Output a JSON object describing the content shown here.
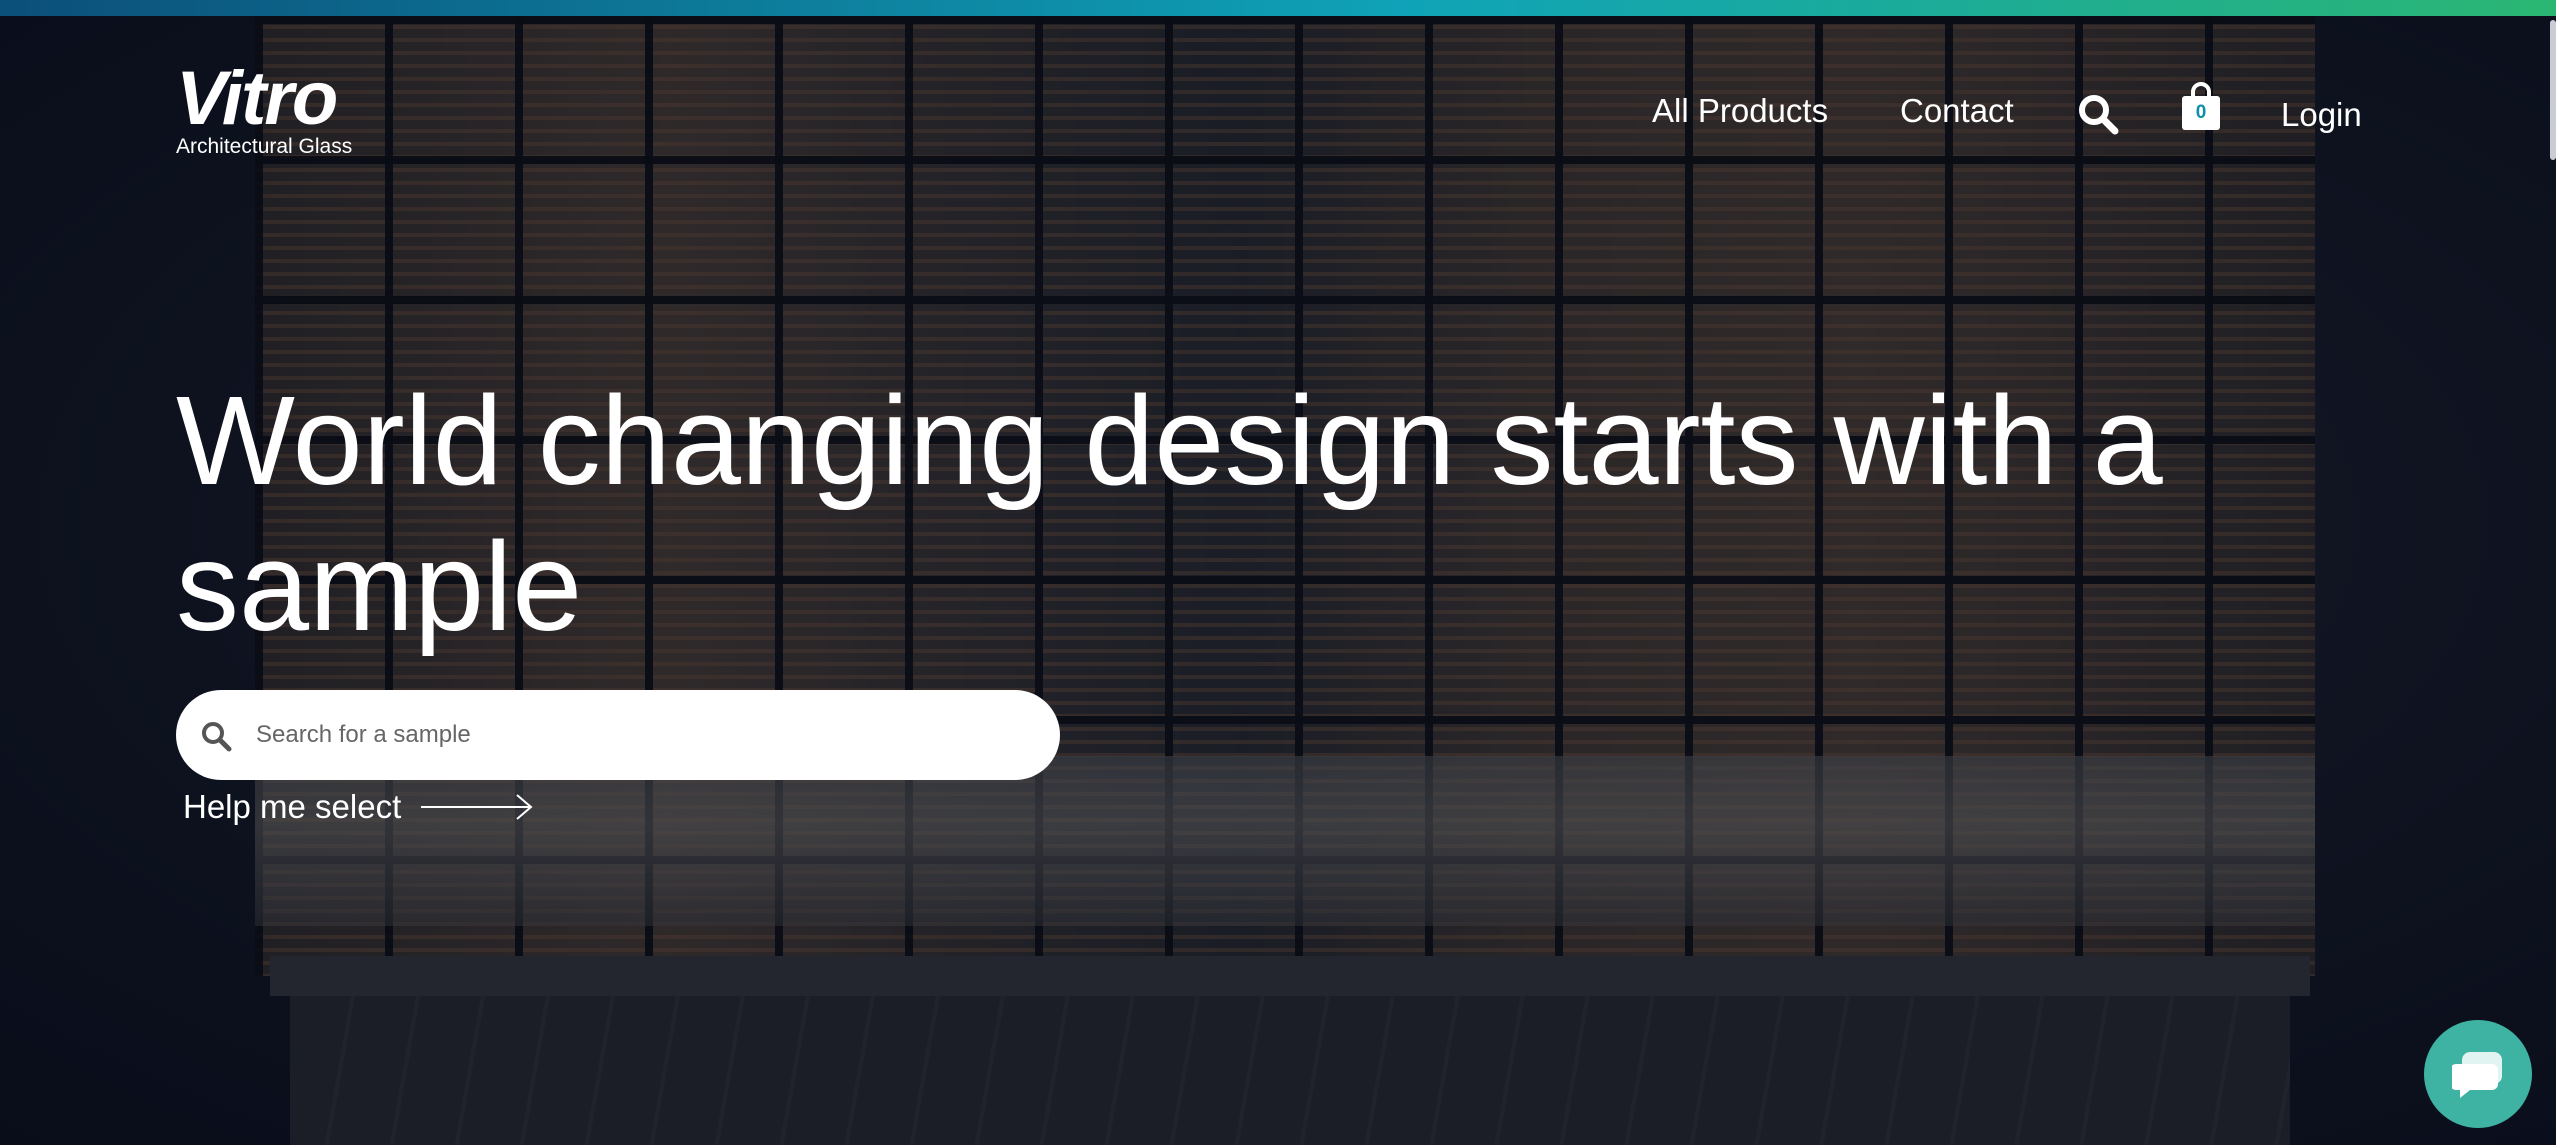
{
  "brand": {
    "logo_text": "Vitro",
    "logo_subtitle": "Architectural Glass",
    "top_accent_gradient": [
      "#0b4f7a",
      "#0fa3b8",
      "#2bb673"
    ]
  },
  "nav": {
    "all_products": "All Products",
    "contact": "Contact",
    "search_icon": "search-icon",
    "cart_icon": "shopping-bag-icon",
    "cart_count": "0",
    "login": "Login"
  },
  "hero": {
    "headline": "World changing design starts with a sample",
    "search_placeholder": "Search for a sample",
    "help_link": "Help me select"
  },
  "chat": {
    "icon": "chat-bubble-icon",
    "color": "#3fb3a3"
  }
}
